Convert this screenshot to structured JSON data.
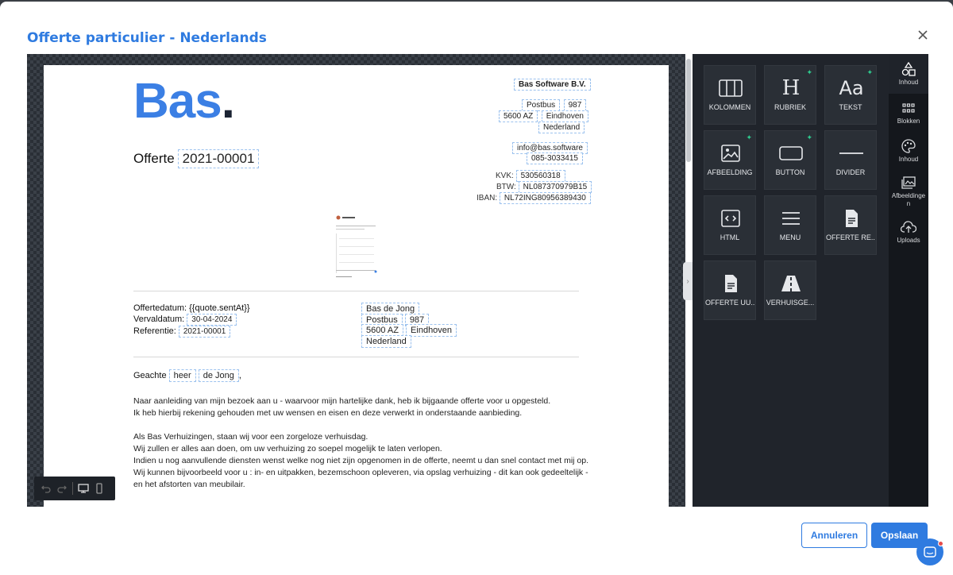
{
  "modal": {
    "title": "Offerte particulier - Nederlands"
  },
  "document": {
    "logo_text": "Bas",
    "logo_dot": ".",
    "company": "Bas Software B.V.",
    "address": {
      "street": "Postbus",
      "number": "987",
      "zip": "5600 AZ",
      "city": "Eindhoven",
      "country": "Nederland"
    },
    "email": "info@bas.software",
    "phone": "085-3033415",
    "kvk_label": "KVK:",
    "kvk": "530560318",
    "btw_label": "BTW:",
    "btw": "NL087370979B15",
    "iban_label": "IBAN:",
    "iban": "NL72ING80956389430",
    "offerte_label": "Offerte",
    "offerte_number": "2021-00001",
    "offertedatum_label": "Offertedatum:",
    "offertedatum": "{{quote.sentAt}}",
    "vervaldatum_label": "Vervaldatum:",
    "vervaldatum": "30-04-2024",
    "referentie_label": "Referentie:",
    "referentie": "2021-00001",
    "customer": {
      "name": "Bas de Jong",
      "street": "Postbus",
      "number": "987",
      "zip": "5600 AZ",
      "city": "Eindhoven",
      "country": "Nederland"
    },
    "greeting_prefix": "Geachte",
    "greeting_title": "heer",
    "greeting_name": "de Jong",
    "greeting_suffix": ",",
    "paragraph1": [
      "Naar aanleiding van mijn bezoek aan u - waarvoor mijn hartelijke dank, heb ik bijgaande offerte voor u opgesteld.",
      "Ik heb hierbij rekening gehouden met uw wensen en eisen en deze verwerkt in onderstaande aanbieding."
    ],
    "paragraph2": [
      "Als Bas Verhuizingen, staan wij voor een zorgeloze verhuisdag.",
      "Wij zullen er alles aan doen, om uw verhuizing zo soepel mogelijk te laten verlopen.",
      "Indien u nog aanvullende diensten wenst welke nog niet zijn opgenomen in de offerte, neemt u dan snel contact met mij op.",
      "Wij kunnen bijvoorbeeld voor u : in- en uitpakken, bezemschoon opleveren, via opslag verhuizing - dit kan ook gedeeltelijk -",
      "en het afstorten van meubilair."
    ]
  },
  "tiles": [
    {
      "label": "KOLOMMEN",
      "icon": "columns-icon",
      "spark": false
    },
    {
      "label": "RUBRIEK",
      "icon": "heading-icon",
      "spark": true
    },
    {
      "label": "TEKST",
      "icon": "text-icon",
      "spark": true
    },
    {
      "label": "AFBEELDING",
      "icon": "image-icon",
      "spark": true
    },
    {
      "label": "BUTTON",
      "icon": "button-icon",
      "spark": true
    },
    {
      "label": "DIVIDER",
      "icon": "divider-icon",
      "spark": false
    },
    {
      "label": "HTML",
      "icon": "html-icon",
      "spark": false
    },
    {
      "label": "MENU",
      "icon": "menu-icon",
      "spark": false
    },
    {
      "label": "OFFERTE RE...",
      "icon": "document-icon",
      "spark": false
    },
    {
      "label": "OFFERTE UU...",
      "icon": "document-icon",
      "spark": false
    },
    {
      "label": "VERHUISGE...",
      "icon": "road-icon",
      "spark": false
    }
  ],
  "sidebar": [
    {
      "label": "Inhoud",
      "icon": "shapes-icon"
    },
    {
      "label": "Blokken",
      "icon": "blocks-icon"
    },
    {
      "label": "Inhoud",
      "icon": "palette-icon"
    },
    {
      "label": "Afbeeldingen",
      "icon": "images-icon"
    },
    {
      "label": "Uploads",
      "icon": "upload-icon"
    }
  ],
  "buttons": {
    "cancel": "Annuleren",
    "save": "Opslaan"
  }
}
